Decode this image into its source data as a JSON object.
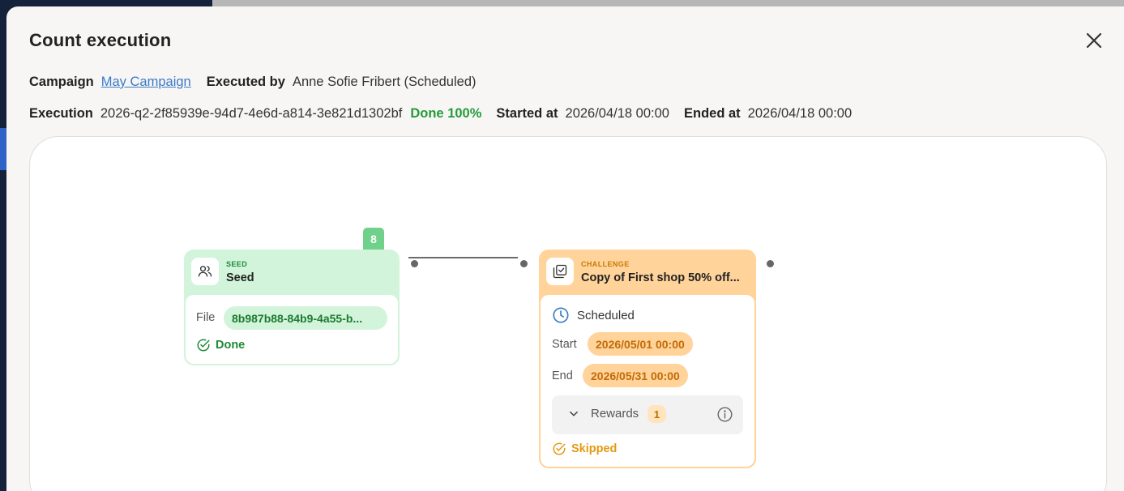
{
  "modal": {
    "title": "Count execution"
  },
  "meta": {
    "campaign_label": "Campaign",
    "campaign_value": "May Campaign",
    "executed_by_label": "Executed by",
    "executed_by_value": "Anne Sofie Fribert (Scheduled)",
    "execution_label": "Execution",
    "execution_id": "2026-q2-2f85939e-94d7-4e6d-a814-3e821d1302bf",
    "status": "Done 100%",
    "started_label": "Started at",
    "started_value": "2026/04/18 00:00",
    "ended_label": "Ended at",
    "ended_value": "2026/04/18 00:00"
  },
  "flow": {
    "seed": {
      "kind": "SEED",
      "name": "Seed",
      "count": "8",
      "file_label": "File",
      "file_value": "8b987b88-84b9-4a55-b...",
      "status": "Done",
      "icon": "users-icon"
    },
    "challenge": {
      "kind": "CHALLENGE",
      "name": "Copy of First shop 50% off...",
      "schedule": "Scheduled",
      "start_label": "Start",
      "start_value": "2026/05/01 00:00",
      "end_label": "End",
      "end_value": "2026/05/31 00:00",
      "rewards_label": "Rewards",
      "rewards_count": "1",
      "status": "Skipped",
      "icon": "checklist-icon"
    }
  },
  "colors": {
    "seed_accent": "#d2f4da",
    "challenge_accent": "#ffd39a",
    "done_green": "#239b3a",
    "skipped_orange": "#e39a11",
    "link_blue": "#3b7ac9"
  }
}
